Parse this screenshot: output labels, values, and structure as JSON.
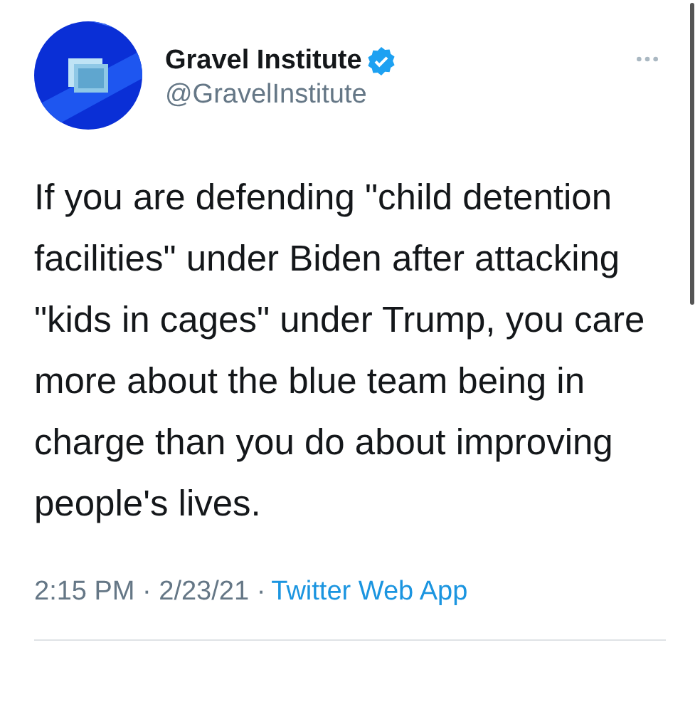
{
  "author": {
    "name": "Gravel Institute",
    "handle": "@GravelInstitute",
    "verified": true
  },
  "text": "If you are defending \"child detention facilities\" under Biden after attacking \"kids in cages\" under Trump, you care more about the blue team being in charge than you do about improving people's lives.",
  "meta": {
    "timestamp": "2:15 PM · 2/23/21 ·",
    "source": "Twitter Web App"
  }
}
